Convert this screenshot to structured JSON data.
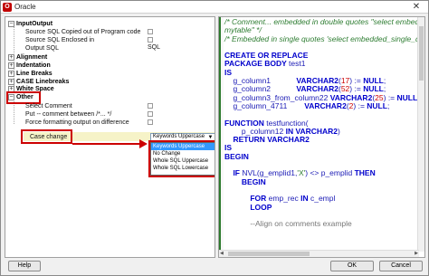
{
  "window": {
    "title": "Oracle",
    "icon_name": "oracle-app-icon"
  },
  "tree": {
    "sections": [
      {
        "label": "InputOutput",
        "expanded": true
      },
      {
        "label": "Alignment",
        "expanded": false
      },
      {
        "label": "Indentation",
        "expanded": false
      },
      {
        "label": "Line Breaks",
        "expanded": false
      },
      {
        "label": "CASE Linebreaks",
        "expanded": false
      },
      {
        "label": "White Space",
        "expanded": false
      },
      {
        "label": "Other",
        "expanded": true
      }
    ],
    "inputoutput_items": [
      {
        "label": "Source SQL Copied out of Program code",
        "value": ""
      },
      {
        "label": "Source SQL Enclosed in",
        "value": ""
      },
      {
        "label": "Output SQL",
        "value": "SQL"
      }
    ],
    "other_items": [
      {
        "label": "Select Comment"
      },
      {
        "label": "Put -- comment between /*... */"
      },
      {
        "label": "Force formatting output on difference"
      }
    ],
    "case_change_label": "Case change",
    "case_change_value": "Keywords Uppercase",
    "dropdown_options": [
      "Keywords Uppercase",
      "No Change",
      "Whole SQL Uppercase",
      "Whole SQL Lowercase"
    ],
    "dropdown_selected_index": 0
  },
  "editor": {
    "lines": [
      [
        {
          "t": "/* Comment... embedded in double quotes \"select embedd",
          "c": "comment"
        }
      ],
      [
        {
          "t": "mytable\" */",
          "c": "comment"
        }
      ],
      [
        {
          "t": "/* Embedded in single quotes 'select embedded_single_qu",
          "c": "comment"
        }
      ],
      [
        {
          "t": "",
          "c": "plain"
        }
      ],
      [
        {
          "t": "CREATE OR REPLACE",
          "c": "kw"
        }
      ],
      [
        {
          "t": "PACKAGE BODY ",
          "c": "kw"
        },
        {
          "t": "test1",
          "c": "plain"
        }
      ],
      [
        {
          "t": "IS",
          "c": "kw"
        }
      ],
      [
        {
          "t": "    g_column1            ",
          "c": "plain"
        },
        {
          "t": "VARCHAR2",
          "c": "kw"
        },
        {
          "t": "(",
          "c": "plain"
        },
        {
          "t": "17",
          "c": "num"
        },
        {
          "t": ") := ",
          "c": "plain"
        },
        {
          "t": "NULL",
          "c": "kw"
        },
        {
          "t": ";",
          "c": "plain"
        }
      ],
      [
        {
          "t": "    g_column2            ",
          "c": "plain"
        },
        {
          "t": "VARCHAR2",
          "c": "kw"
        },
        {
          "t": "(",
          "c": "plain"
        },
        {
          "t": "52",
          "c": "num"
        },
        {
          "t": ") := ",
          "c": "plain"
        },
        {
          "t": "NULL",
          "c": "kw"
        },
        {
          "t": ";",
          "c": "plain"
        }
      ],
      [
        {
          "t": "    g_column3_from_column22 ",
          "c": "plain"
        },
        {
          "t": "VARCHAR2",
          "c": "kw"
        },
        {
          "t": "(",
          "c": "plain"
        },
        {
          "t": "25",
          "c": "num"
        },
        {
          "t": ") := ",
          "c": "plain"
        },
        {
          "t": "NULL",
          "c": "kw"
        },
        {
          "t": ";",
          "c": "plain"
        }
      ],
      [
        {
          "t": "    g_column_4711        ",
          "c": "plain"
        },
        {
          "t": "VARCHAR2",
          "c": "kw"
        },
        {
          "t": "(",
          "c": "plain"
        },
        {
          "t": "2",
          "c": "num"
        },
        {
          "t": ") := ",
          "c": "plain"
        },
        {
          "t": "NULL",
          "c": "kw"
        },
        {
          "t": ";",
          "c": "plain"
        }
      ],
      [
        {
          "t": "",
          "c": "plain"
        }
      ],
      [
        {
          "t": "FUNCTION ",
          "c": "kw"
        },
        {
          "t": "testfunction(",
          "c": "plain"
        }
      ],
      [
        {
          "t": "        p_column12 ",
          "c": "plain"
        },
        {
          "t": "IN VARCHAR2",
          "c": "kw"
        },
        {
          "t": ")",
          "c": "plain"
        }
      ],
      [
        {
          "t": "    RETURN VARCHAR2",
          "c": "kw"
        }
      ],
      [
        {
          "t": "IS",
          "c": "kw"
        }
      ],
      [
        {
          "t": "BEGIN",
          "c": "kw"
        }
      ],
      [
        {
          "t": "",
          "c": "plain"
        }
      ],
      [
        {
          "t": "    IF ",
          "c": "kw"
        },
        {
          "t": "NVL(g_emplid1,",
          "c": "plain"
        },
        {
          "t": "'X'",
          "c": "str"
        },
        {
          "t": ") <> p_emplid ",
          "c": "plain"
        },
        {
          "t": "THEN",
          "c": "kw"
        }
      ],
      [
        {
          "t": "        BEGIN",
          "c": "kw"
        }
      ],
      [
        {
          "t": "",
          "c": "plain"
        }
      ],
      [
        {
          "t": "            FOR ",
          "c": "kw"
        },
        {
          "t": "emp_rec ",
          "c": "plain"
        },
        {
          "t": "IN ",
          "c": "kw"
        },
        {
          "t": "c_empl",
          "c": "plain"
        }
      ],
      [
        {
          "t": "            LOOP",
          "c": "kw"
        }
      ],
      [
        {
          "t": "",
          "c": "plain"
        }
      ],
      [
        {
          "t": "            --Align on comments example",
          "c": "gray"
        }
      ]
    ]
  },
  "buttons": {
    "help": "Help",
    "ok": "OK",
    "cancel": "Cancel"
  },
  "colors": {
    "highlight": "#cc0000",
    "keyword": "#0000cc",
    "comment": "#2e7d32",
    "number": "#cc0000",
    "selection": "#3399ff"
  }
}
